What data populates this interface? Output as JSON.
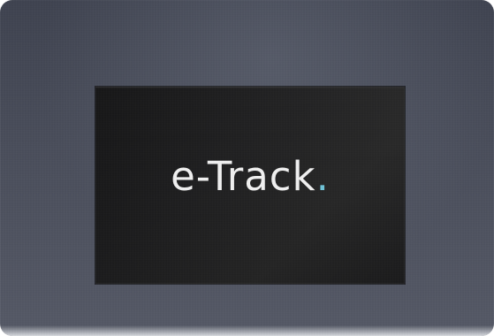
{
  "logo": {
    "text": "e-Track",
    "dot": "."
  },
  "colors": {
    "frame": "#4a4e5b",
    "screen": "#1a1a1b",
    "logo_text": "#f2f2f2",
    "logo_dot": "#6fc3d9"
  }
}
